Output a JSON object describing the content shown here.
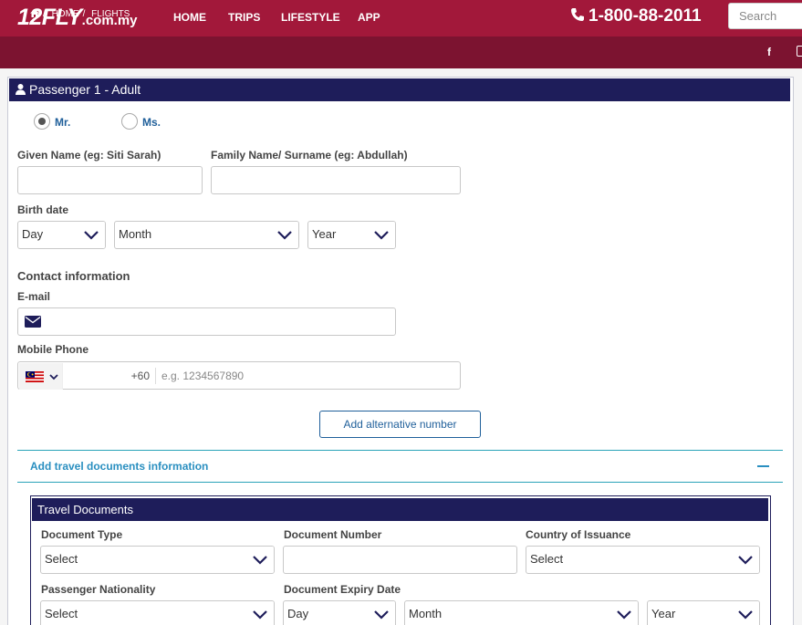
{
  "header": {
    "logo_main": "12FLY",
    "logo_suffix": ".com.my",
    "nav": [
      "HOME",
      "TRIPS",
      "LIFESTYLE",
      "APP"
    ],
    "phone": "1-800-88-2011",
    "search_placeholder": "Search"
  },
  "breadcrumb": {
    "items": [
      "HOME",
      "FLIGHTS"
    ],
    "separator": "/"
  },
  "social": {
    "facebook": "f"
  },
  "passenger": {
    "title": "Passenger 1 - Adult",
    "salutations": [
      {
        "label": "Mr.",
        "selected": true
      },
      {
        "label": "Ms.",
        "selected": false
      }
    ],
    "given_name_label": "Given Name (eg: Siti Sarah)",
    "family_name_label": "Family Name/ Surname (eg: Abdullah)",
    "birth_date_label": "Birth date",
    "birth_day": "Day",
    "birth_month": "Month",
    "birth_year": "Year",
    "contact_title": "Contact information",
    "email_label": "E-mail",
    "mobile_label": "Mobile Phone",
    "dial_code": "+60",
    "phone_placeholder": "e.g. 1234567890",
    "add_alt_number": "Add alternative number",
    "travel_docs_toggle": "Add travel documents information"
  },
  "travel_documents": {
    "title": "Travel Documents",
    "document_type_label": "Document Type",
    "document_type_value": "Select",
    "document_number_label": "Document Number",
    "country_label": "Country of Issuance",
    "country_value": "Select",
    "nationality_label": "Passenger Nationality",
    "nationality_value": "Select",
    "expiry_label": "Document Expiry Date",
    "expiry_day": "Day",
    "expiry_month": "Month",
    "expiry_year": "Year"
  },
  "colors": {
    "brand": "#a2183a",
    "brand_dark": "#7c1330",
    "navy": "#1e1d5a",
    "link": "#1f5f9a",
    "accent": "#2aa3b9"
  },
  "icons": [
    "phone-icon",
    "home-icon",
    "facebook-icon",
    "instagram-icon",
    "user-icon",
    "envelope-icon",
    "malaysia-flag-icon",
    "chevron-down-icon",
    "minus-icon"
  ]
}
